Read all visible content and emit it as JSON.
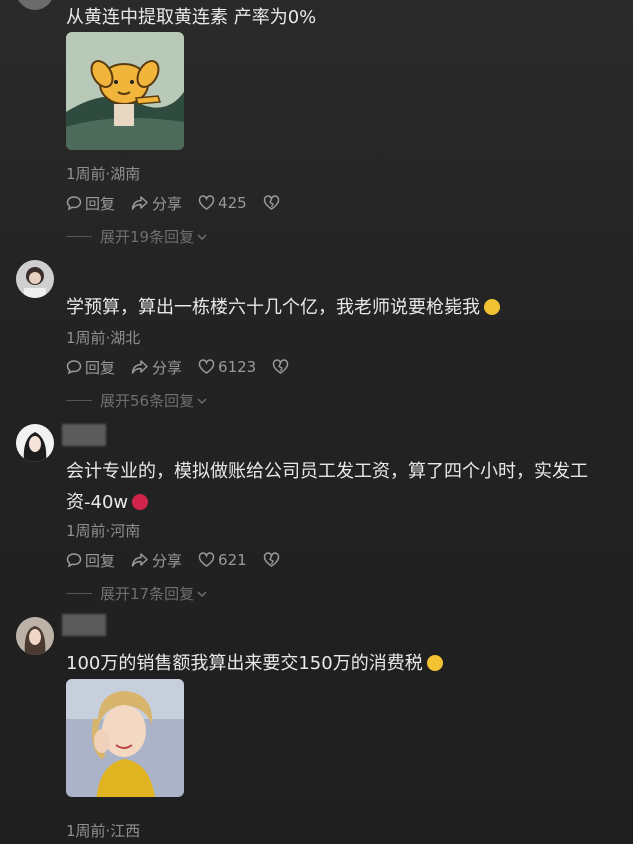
{
  "comments": [
    {
      "text": "从黄连中提取黄连素 产率为0%",
      "meta": "1周前·湖南",
      "reply_label": "回复",
      "share_label": "分享",
      "likes": "425",
      "expand": "展开19条回复"
    },
    {
      "text": "学预算，算出一栋楼六十几个亿，我老师说要枪毙我",
      "meta": "1周前·湖北",
      "reply_label": "回复",
      "share_label": "分享",
      "likes": "6123",
      "expand": "展开56条回复"
    },
    {
      "text": "会计专业的，模拟做账给公司员工发工资，算了四个小时，实发工资-40w",
      "meta": "1周前·河南",
      "reply_label": "回复",
      "share_label": "分享",
      "likes": "621",
      "expand": "展开17条回复"
    },
    {
      "text": "100万的销售额我算出来要交150万的消费税",
      "meta": "1周前·江西"
    }
  ],
  "icons": {
    "reply": "speech-bubble-icon",
    "share": "share-arrow-icon",
    "like": "heart-icon",
    "dislike": "broken-heart-icon",
    "expand": "chevron-down-icon"
  }
}
